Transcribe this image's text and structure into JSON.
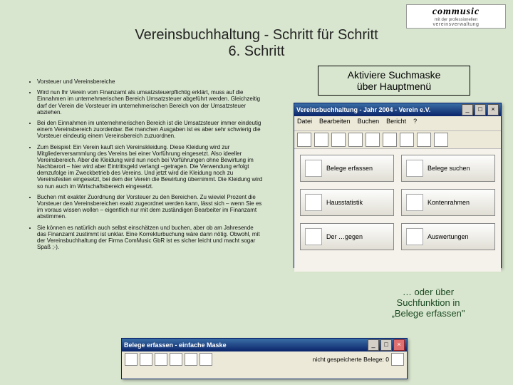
{
  "logo": {
    "line1": "commusic",
    "line2": "mit der professionellen",
    "line3": "vereinsverwaltung"
  },
  "title": {
    "line1": "Vereinsbuchhaltung - Schritt für Schritt",
    "line2": "6. Schritt"
  },
  "callout1": {
    "line1": "Aktiviere Suchmaske",
    "line2": "über Hauptmenü"
  },
  "callout2": {
    "line1": "… oder über",
    "line2": "Suchfunktion in",
    "line3": "„Belege erfassen\""
  },
  "bullets": [
    "Vorsteuer und Vereinsbereiche",
    "Wird nun Ihr Verein vom Finanzamt als umsatzsteuer­pflichtig erklärt, muss auf die Einnahmen im unterneh­merischen Bereich Umsatzsteuer abgeführt werden. Gleichzeitig darf der Verein die Vorsteuer im unter­nehmerischen Bereich von der Umsatzsteuer abziehen.",
    "Bei den Einnahmen im unternehmerischen Bereich ist die Umsatzsteuer immer eindeutig einem Vereinsbereich zuordenbar. Bei manchen Ausgaben ist es aber sehr schwierig die Vorsteuer eindeutig einem Vereinsbereich zuzuordnen.",
    "Zum Beispiel: Ein Verein kauft sich Vereinskleidung. Diese Kleidung wird zur Mitgliederversammlung des Vereins bei einer Vorführung eingesetzt. Also ideeller Vereinsbereich. Aber die Kleidung wird nun noch bei Vorführungen ohne Bewirtung im Nachbarort – hier wird aber Eintrittsgeld verlangt –getragen. Die Verwendung erfolgt demzufolge im Zweckbetrieb des Vereins. Und jetzt wird die Kleidung noch zu Vereinsfesten eingesetzt, bei dem der Verein die Bewirtung übernimmt. Die Kleidung wird so nun auch im Wirtschaftsbereich eingesetzt.",
    "Buchen mit exakter Zuordnung der Vorsteuer zu den Bereichen. Zu wieviel Prozent die Vorsteuer den Vereinsbereichen exakt zugeordnet werden kann, lässt sich – wenn Sie es im voraus wissen wollen – eigentlich nur mit dem zuständigen Bearbeiter im Finanzamt abstimmen.",
    "Sie können es natürlich auch selbst einschätzen und buchen, aber ob am Jahresende das Finanzamt zustimmt ist unklar. Eine Korrekturbuchung wäre dann nötig. Obwohl, mit der Vereinsbuchhaltung der Firma ComMusic GbR ist es sicher leicht und macht sogar Spaß ;-)."
  ],
  "win1": {
    "title": "Vereinsbuchhaltung - Jahr 2004 - Verein e.V.",
    "menu": [
      "Datei",
      "Bearbeiten",
      "Buchen",
      "Bericht",
      "?"
    ],
    "buttons": {
      "r1a": "Belege erfassen",
      "r1b": "Belege suchen",
      "r2a": "Hausstatistik",
      "r2b": "Kontenrahmen",
      "r3a": "Der …gegen",
      "r3b": "Auswertungen"
    }
  },
  "win2": {
    "title": "Belege erfassen - einfache Maske",
    "status": "nicht gespeicherte Belege: 0"
  }
}
